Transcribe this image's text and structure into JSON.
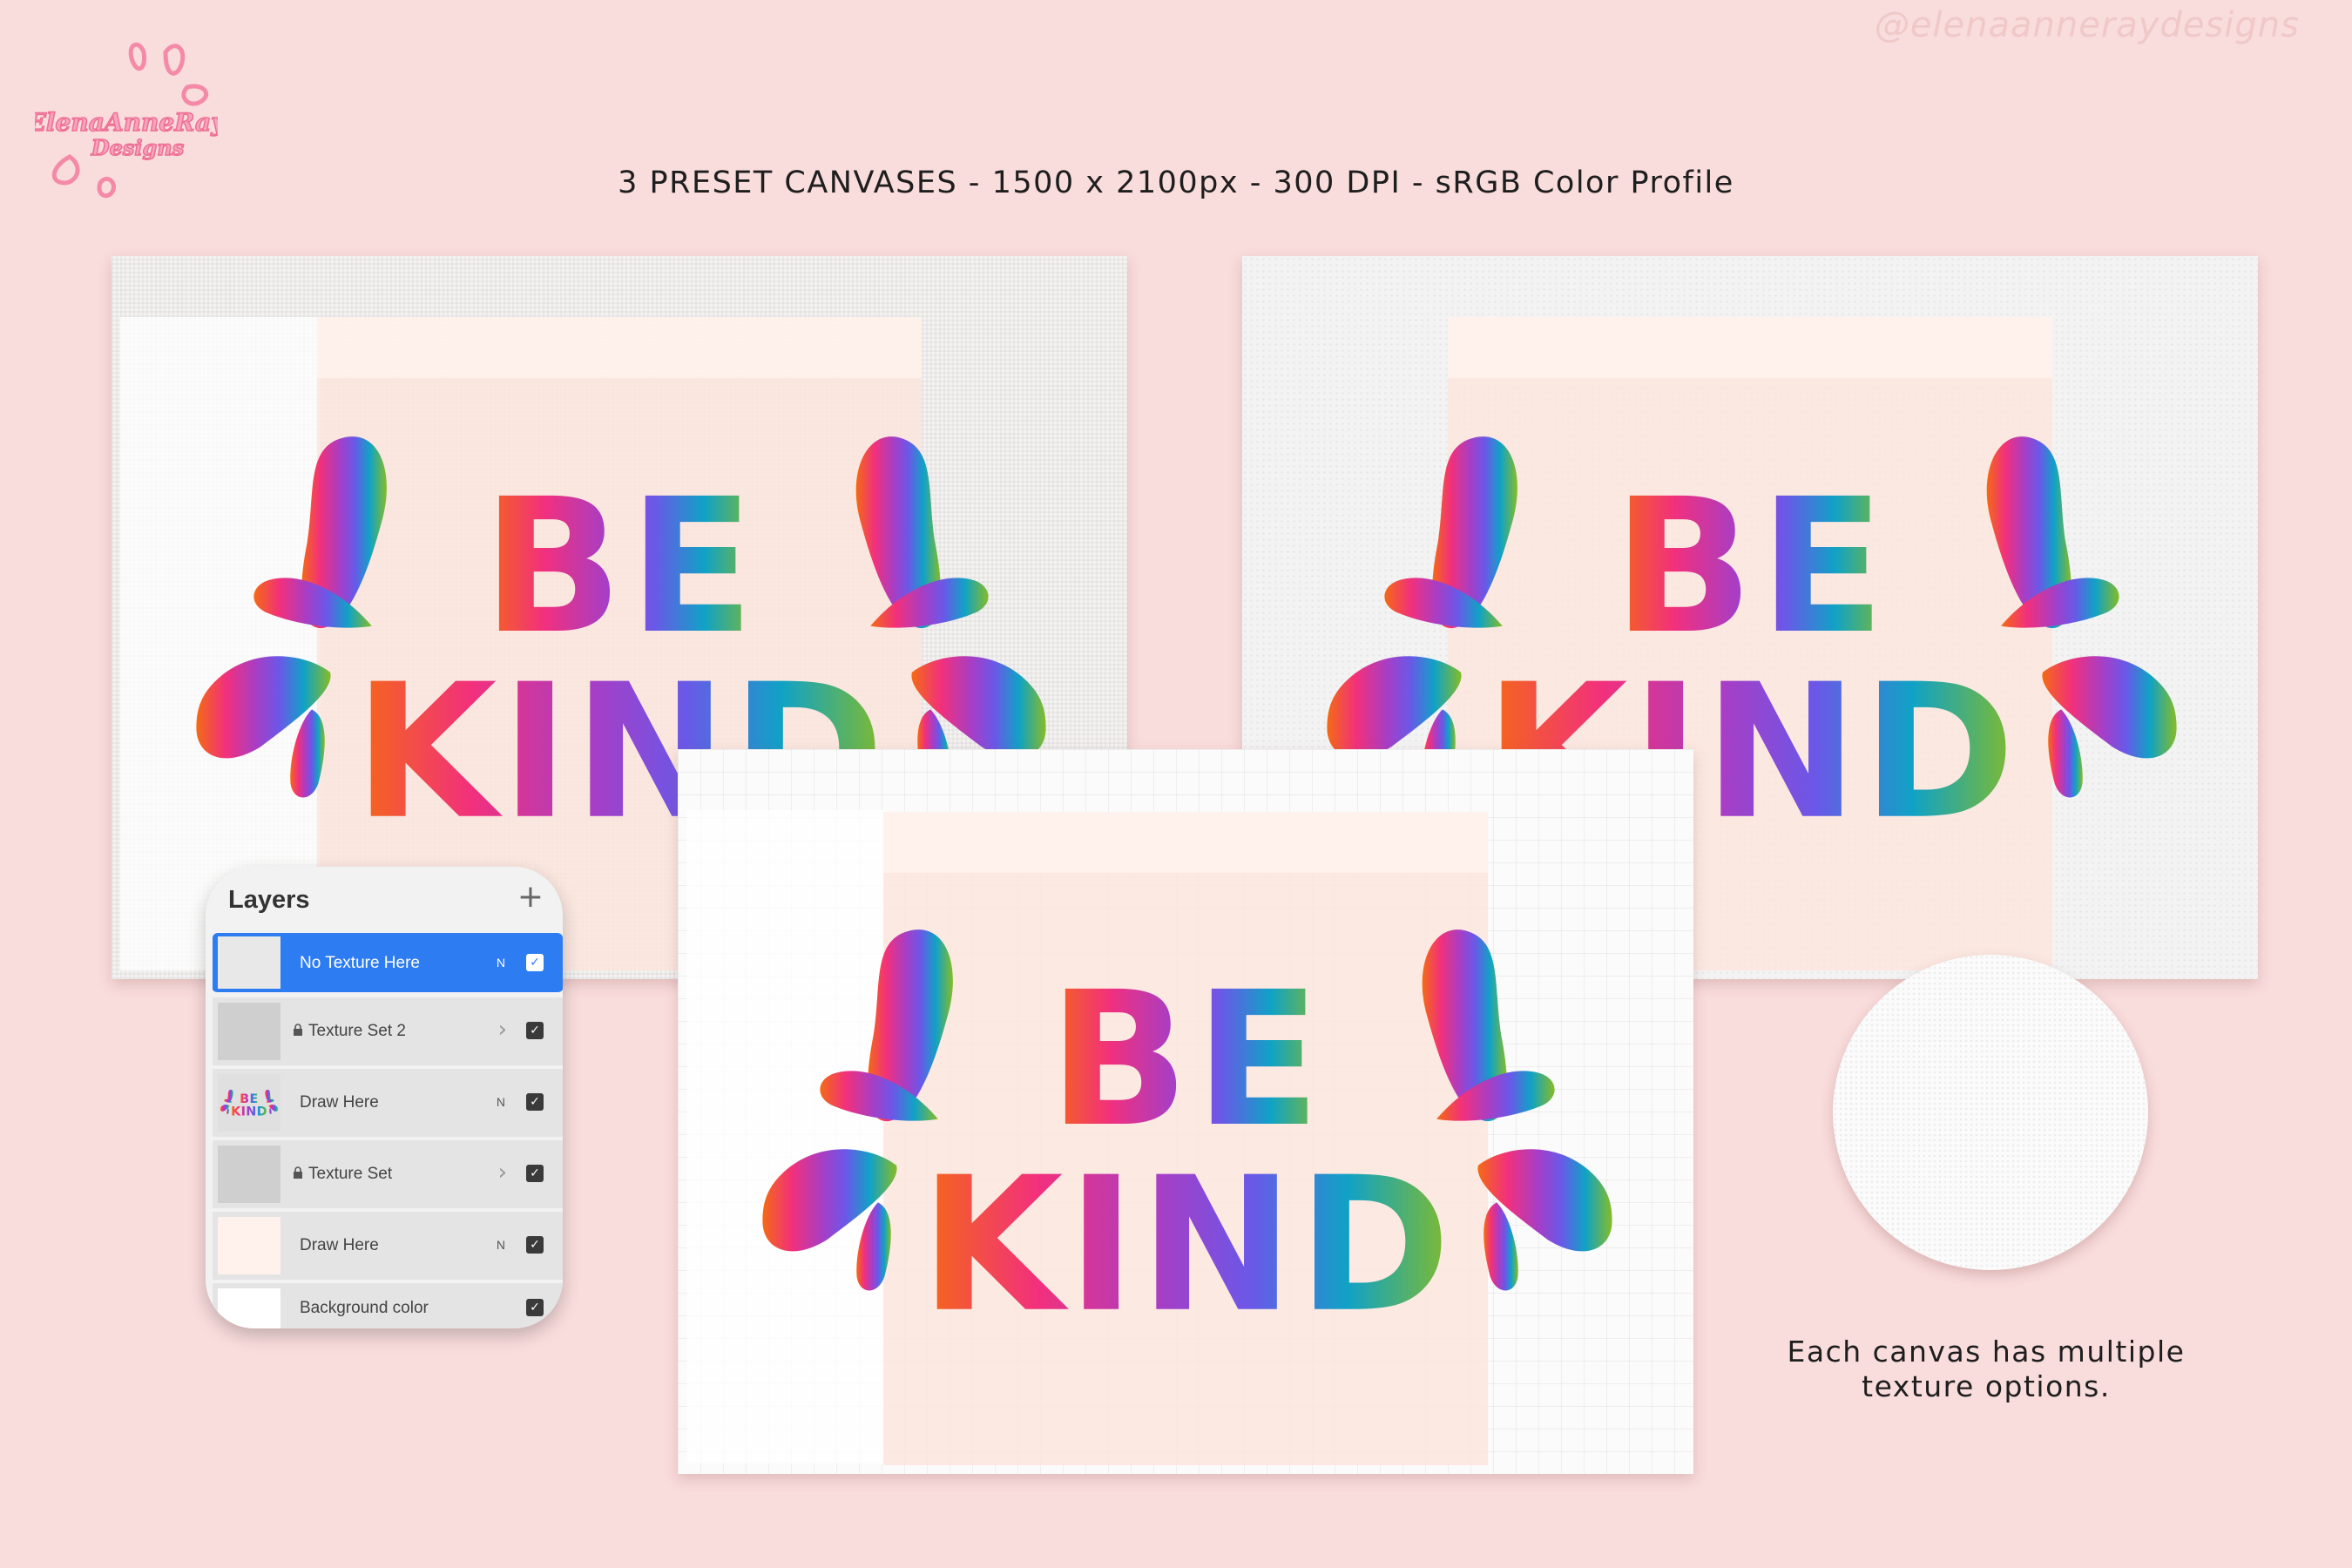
{
  "brand": {
    "logo_text": "ElenaAnneRay Designs",
    "watermark": "@elenaanneraydesigns"
  },
  "headline": "3 PRESET CANVASES - 1500 x 2100px - 300 DPI - sRGB Color Profile",
  "artwork": {
    "line1": "BE",
    "line2": "KIND"
  },
  "layers_panel": {
    "title": "Layers",
    "add_icon": "plus-icon",
    "layers": [
      {
        "name": "No Texture Here",
        "mode": "N",
        "visible": true,
        "active": true
      },
      {
        "name": "Texture Set 2",
        "mode": "",
        "visible": true,
        "locked": true,
        "group": true
      },
      {
        "name": "Draw Here",
        "mode": "N",
        "visible": true
      },
      {
        "name": "Texture Set",
        "mode": "",
        "visible": true,
        "locked": true,
        "group": true
      },
      {
        "name": "Draw Here",
        "mode": "N",
        "visible": true
      },
      {
        "name": "Background color",
        "mode": "",
        "visible": true
      }
    ]
  },
  "caption": {
    "line1": "Each canvas has multiple",
    "line2": "texture options."
  },
  "colors": {
    "background": "#f9dcdc",
    "active_layer": "#2d7cf2",
    "gradient": [
      "#f27a1d",
      "#f0307a",
      "#a23cc8",
      "#6a5ae8",
      "#12a3c8",
      "#8abb2a"
    ]
  }
}
